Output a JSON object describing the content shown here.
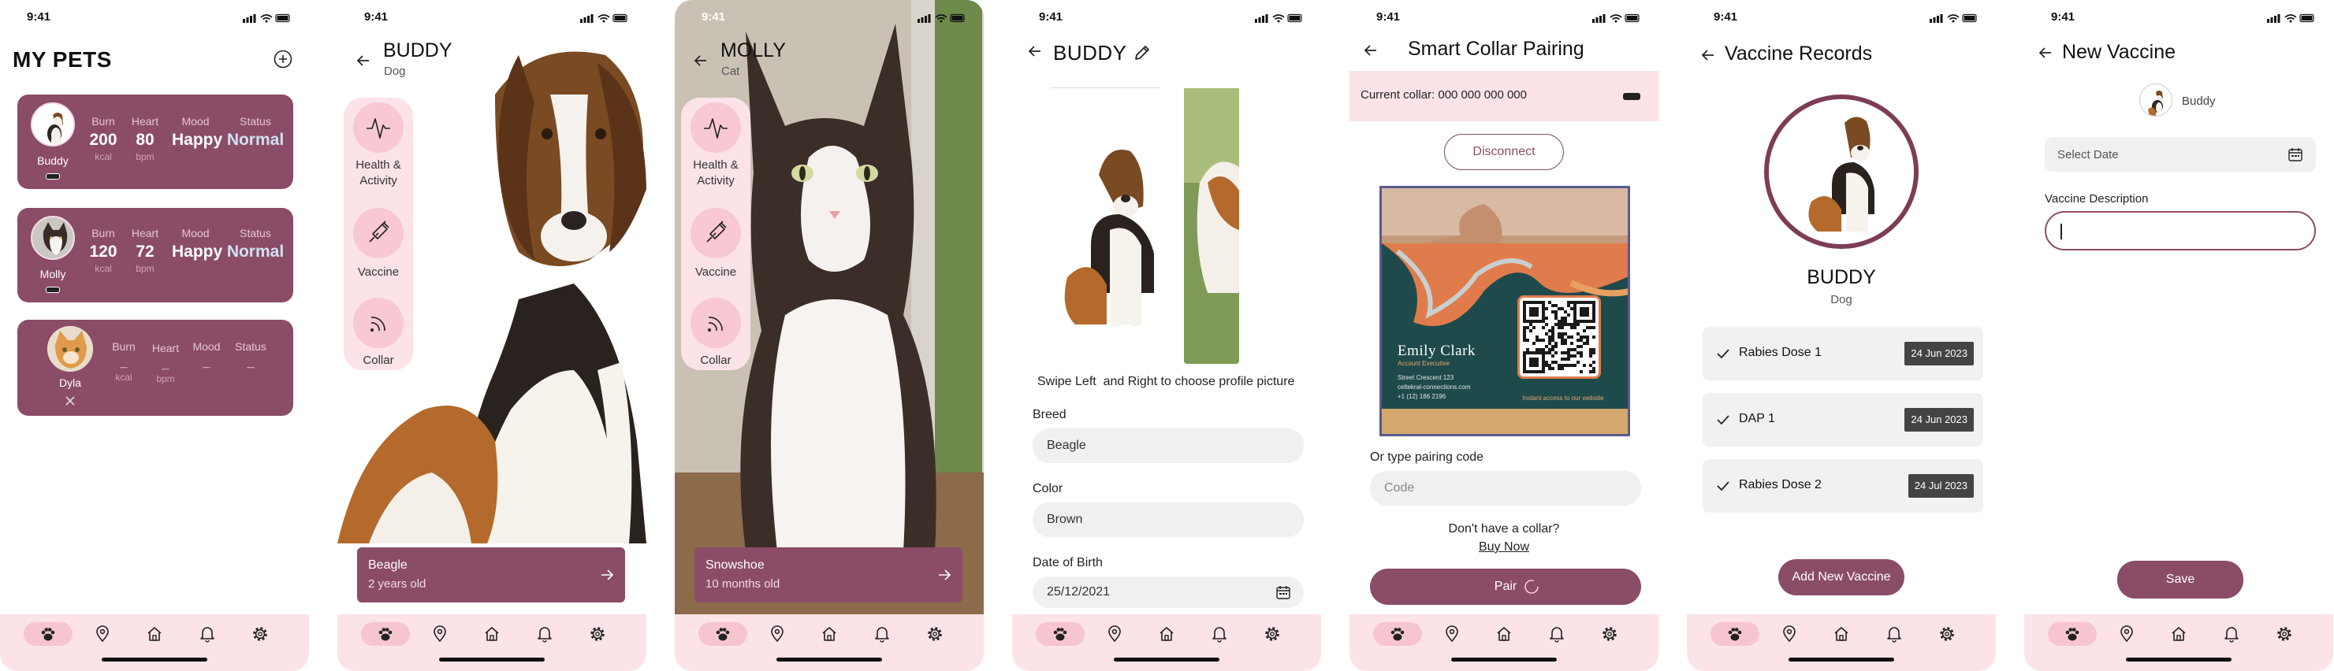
{
  "status_time": "9:41",
  "screen1": {
    "title": "MY PETS",
    "pets": [
      {
        "name": "Buddy",
        "burn_label": "Burn",
        "burn": "200",
        "burn_unit": "kcal",
        "heart_label": "Heart",
        "heart": "80",
        "heart_unit": "bpm",
        "mood_label": "Mood",
        "mood": "Happy",
        "status_label": "Status",
        "status": "Normal"
      },
      {
        "name": "Molly",
        "burn_label": "Burn",
        "burn": "120",
        "burn_unit": "kcal",
        "heart_label": "Heart",
        "heart": "72",
        "heart_unit": "bpm",
        "mood_label": "Mood",
        "mood": "Happy",
        "status_label": "Status",
        "status": "Normal"
      },
      {
        "name": "Dyla",
        "burn_label": "Burn",
        "burn": "_",
        "burn_unit": "kcal",
        "heart_label": "Heart",
        "heart": "_",
        "heart_unit": "bpm",
        "mood_label": "Mood",
        "mood": "_",
        "status_label": "Status",
        "status": "_"
      }
    ]
  },
  "screen2": {
    "title": "BUDDY",
    "subtitle": "Dog",
    "rail": [
      "Health & Activity",
      "Vaccine",
      "Collar"
    ],
    "info_title": "Beagle",
    "info_sub": "2 years old"
  },
  "screen3": {
    "title": "MOLLY",
    "subtitle": "Cat",
    "rail": [
      "Health & Activity",
      "Vaccine",
      "Collar"
    ],
    "info_title": "Snowshoe",
    "info_sub": "10 months old"
  },
  "screen4": {
    "title": "BUDDY",
    "swipe_hint": "Swipe Left  and Right to choose profile picture",
    "breed_label": "Breed",
    "breed": "Beagle",
    "color_label": "Color",
    "color": "Brown",
    "dob_label": "Date of Birth",
    "dob": "25/12/2021"
  },
  "screen5": {
    "title": "Smart Collar Pairing",
    "current_collar": "Current collar: 000 000 000 000",
    "disconnect": "Disconnect",
    "card_name": "Emily Clark",
    "card_role": "Account Executive",
    "card_lines": [
      "Street Crescent 123",
      "celtekral-connections.com",
      "+1 (12) 186 2196"
    ],
    "card_qr_caption": "Instant access to our website",
    "pairing_label": "Or type pairing code",
    "code_placeholder": "Code",
    "no_collar": "Don't have a collar?",
    "buy_now": "Buy Now",
    "pair": "Pair"
  },
  "screen6": {
    "title": "Vaccine Records",
    "name": "BUDDY",
    "species": "Dog",
    "records": [
      {
        "name": "Rabies Dose 1",
        "date": "24 Jun 2023"
      },
      {
        "name": "DAP 1",
        "date": "24 Jun 2023"
      },
      {
        "name": "Rabies Dose 2",
        "date": "24 Jul 2023"
      }
    ],
    "add_button": "Add New Vaccine"
  },
  "screen7": {
    "title": "New Vaccine",
    "pet_name": "Buddy",
    "date_placeholder": "Select Date",
    "desc_label": "Vaccine Description",
    "save": "Save"
  },
  "colors": {
    "accent": "#8b4c67",
    "soft_pink": "#fbe3e8",
    "pink": "#f8c8d3",
    "status_light": "#cfe2f3"
  },
  "tab_icons": [
    "paw-icon",
    "location-icon",
    "home-icon",
    "bell-icon",
    "gear-icon"
  ]
}
